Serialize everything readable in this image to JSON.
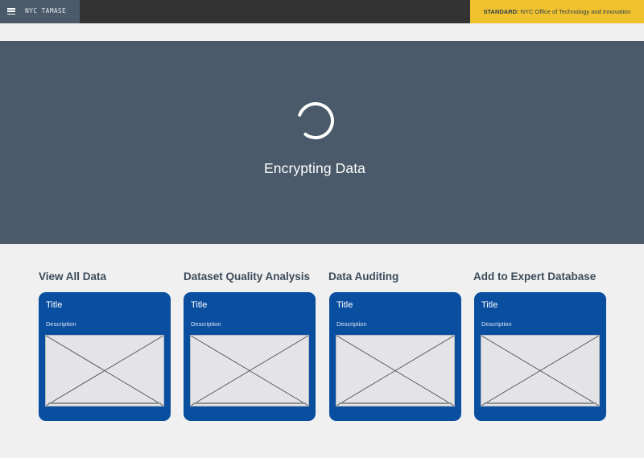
{
  "header": {
    "logo_text": "NYC TAMASE",
    "standard_label": "STANDARD:",
    "standard_text": "NYC Office of Technology and Innovation",
    "menu_icon": "hamburger-menu-icon"
  },
  "hero": {
    "status_text": "Encrypting Data",
    "spinner_icon": "loading-spinner-icon"
  },
  "sections": [
    {
      "heading": "View All Data",
      "card_title": "Title",
      "card_description": "Description"
    },
    {
      "heading": "Dataset Quality Analysis",
      "card_title": "Title",
      "card_description": "Description"
    },
    {
      "heading": "Data Auditing",
      "card_title": "Title",
      "card_description": "Description"
    },
    {
      "heading": "Add to Expert Database",
      "card_title": "Title",
      "card_description": "Description"
    }
  ],
  "colors": {
    "topbar": "#333333",
    "hero": "#4a5a6a",
    "badge": "#f0c22e",
    "card": "#0a4ea0",
    "heading": "#3c4b5a",
    "page": "#f0f0f0"
  }
}
